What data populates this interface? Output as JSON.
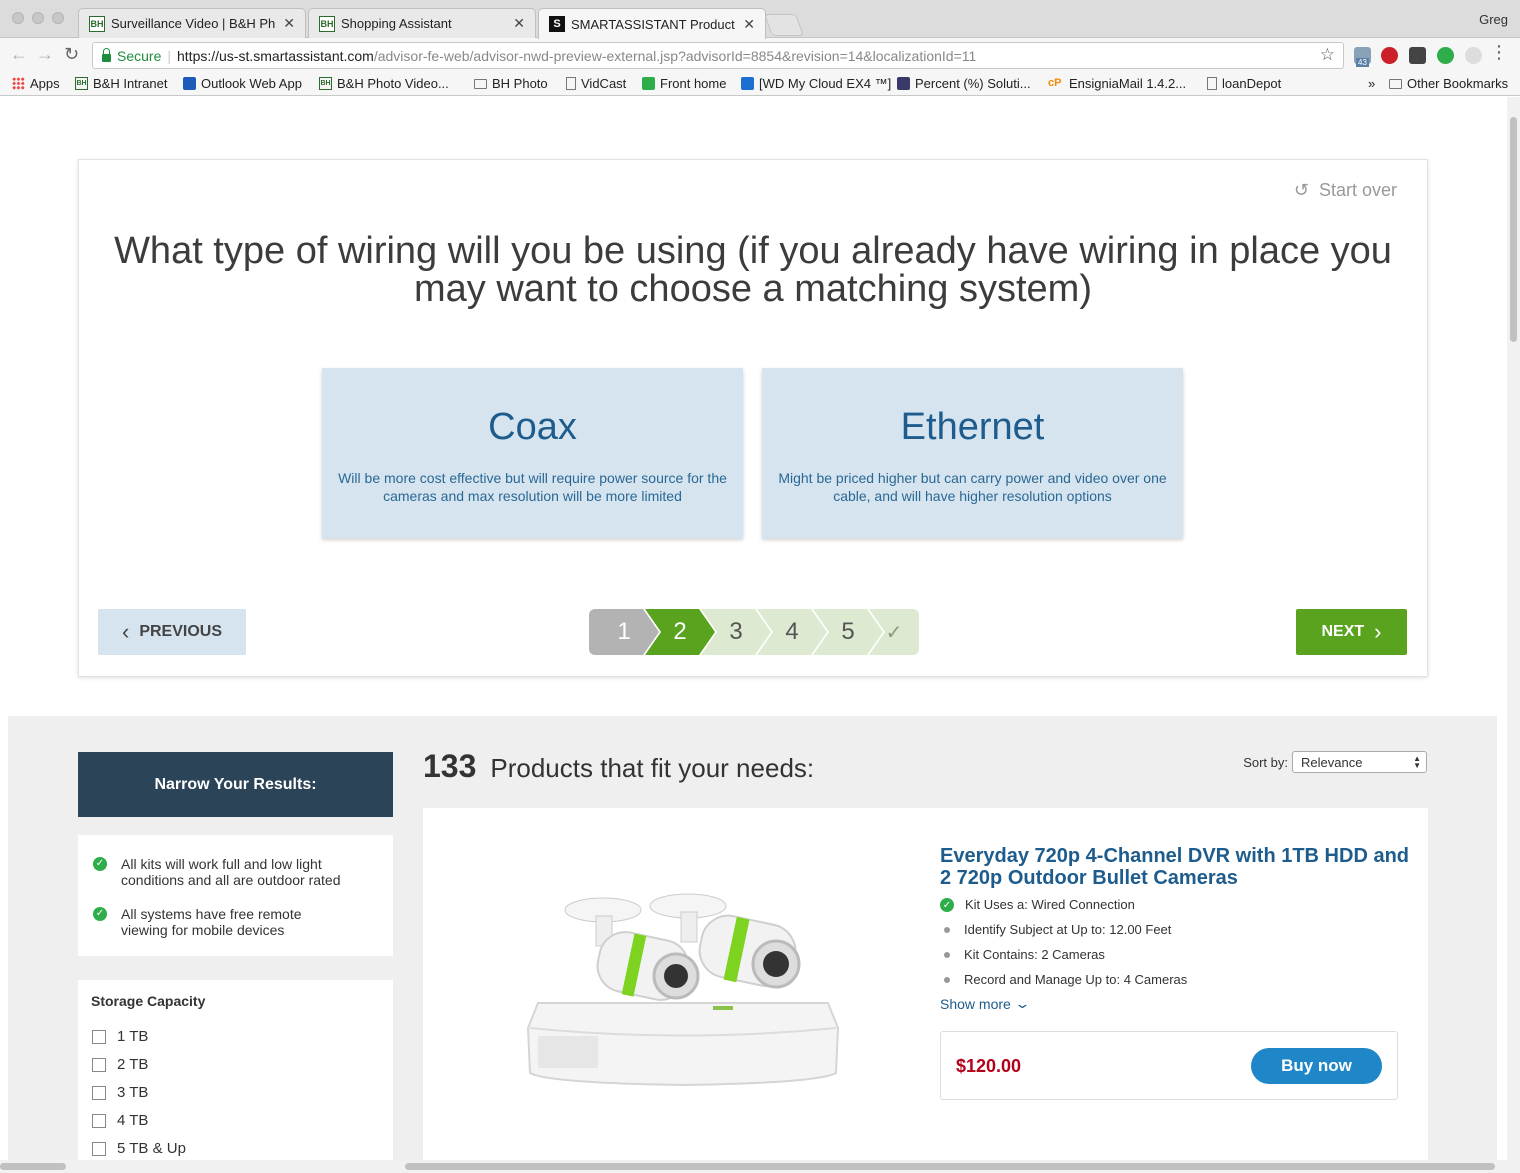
{
  "browser": {
    "profile_name": "Greg",
    "tabs": [
      {
        "favicon": "BH",
        "title": "Surveillance Video | B&H Phot"
      },
      {
        "favicon": "BH",
        "title": "Shopping Assistant"
      },
      {
        "favicon": "S",
        "title": "SMARTASSISTANT Product Ad"
      }
    ],
    "secure_label": "Secure",
    "url_host": "https://us-st.smartassistant.com",
    "url_path": "/advisor-fe-web/advisor-nwd-preview-external.jsp?advisorId=8854&revision=14&localizationId=11",
    "extension_badge": "43",
    "bookmarks": [
      {
        "icon": "apps-grid-icon",
        "label": "Apps"
      },
      {
        "icon": "bh-icon",
        "label": "B&H Intranet"
      },
      {
        "icon": "outlook-icon",
        "label": "Outlook Web App"
      },
      {
        "icon": "bh-icon",
        "label": "B&H Photo Video..."
      },
      {
        "icon": "folder-icon",
        "label": "BH Photo"
      },
      {
        "icon": "page-icon",
        "label": "VidCast"
      },
      {
        "icon": "front-icon",
        "label": "Front home"
      },
      {
        "icon": "wd-icon",
        "label": "[WD My Cloud EX4 ™]"
      },
      {
        "icon": "percent-icon",
        "label": "Percent (%) Soluti..."
      },
      {
        "icon": "cpanel-icon",
        "label": "EnsigniaMail 1.4.2..."
      },
      {
        "icon": "page-icon",
        "label": "loanDepot"
      }
    ],
    "overflow_label": "»",
    "other_bookmarks": "Other Bookmarks"
  },
  "advisor": {
    "start_over": "Start over",
    "question": "What type of wiring will you be using (if you already have wiring in place you may want to choose a matching system)",
    "options": [
      {
        "title": "Coax",
        "description": "Will be more cost effective but will require power source for the cameras and max resolution will be more limited"
      },
      {
        "title": "Ethernet",
        "description": "Might be priced higher but can carry power and video over one cable, and will have higher resolution options"
      }
    ],
    "previous_label": "PREVIOUS",
    "next_label": "NEXT",
    "steps": [
      "1",
      "2",
      "3",
      "4",
      "5",
      "✓"
    ],
    "current_step": 2
  },
  "results": {
    "narrow_title": "Narrow Your Results:",
    "notes": [
      "All kits will work full and low light conditions and all are outdoor rated",
      "All systems have free remote viewing for mobile devices"
    ],
    "filter": {
      "title": "Storage Capacity",
      "options": [
        "1 TB",
        "2 TB",
        "3 TB",
        "4 TB",
        "5 TB & Up"
      ]
    },
    "count": "133",
    "count_label": "Products that fit your needs:",
    "sort_label": "Sort by:",
    "sort_value": "Relevance",
    "product": {
      "title": "Everyday 720p 4-Channel DVR with 1TB HDD and 2 720p Outdoor Bullet Cameras",
      "features": [
        {
          "text": "Kit Uses a: Wired Connection",
          "matched": true
        },
        {
          "text": "Identify Subject at Up to: 12.00 Feet",
          "matched": false
        },
        {
          "text": "Kit Contains: 2 Cameras",
          "matched": false
        },
        {
          "text": "Record and Manage Up to: 4 Cameras",
          "matched": false
        }
      ],
      "show_more": "Show more",
      "price": "$120.00",
      "buy_label": "Buy now"
    }
  },
  "colors": {
    "accent_green": "#5aa31f",
    "option_bg": "#d6e4ef",
    "title_blue": "#1d5c8c",
    "price_red": "#b3001b",
    "buy_blue": "#1f86c8",
    "narrow_header": "#2b4458"
  }
}
